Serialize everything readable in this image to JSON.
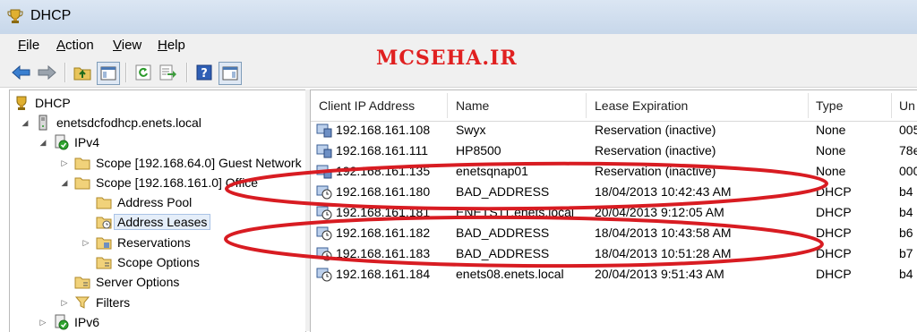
{
  "window": {
    "title": "DHCP"
  },
  "menu": [
    {
      "accel": "F",
      "rest": "ile"
    },
    {
      "accel": "A",
      "rest": "ction"
    },
    {
      "accel": "V",
      "rest": "iew"
    },
    {
      "accel": "H",
      "rest": "elp"
    }
  ],
  "watermark": "MCSEHA.IR",
  "tree": {
    "root": "DHCP",
    "server": "enetsdcfodhcp.enets.local",
    "ipv4": "IPv4",
    "scope1": "Scope [192.168.64.0] Guest Network",
    "scope2": "Scope [192.168.161.0] Office",
    "address_pool": "Address Pool",
    "address_leases": "Address Leases",
    "reservations": "Reservations",
    "scope_options": "Scope Options",
    "server_options": "Server Options",
    "filters": "Filters",
    "ipv6": "IPv6"
  },
  "columns": {
    "ip": "Client IP Address",
    "name": "Name",
    "expiration": "Lease Expiration",
    "type": "Type",
    "unique": "Un"
  },
  "leases": [
    {
      "ip": "192.168.161.108",
      "name": "Swyx",
      "expiration": "Reservation (inactive)",
      "type": "None",
      "unique": "005"
    },
    {
      "ip": "192.168.161.111",
      "name": "HP8500",
      "expiration": "Reservation (inactive)",
      "type": "None",
      "unique": "78e"
    },
    {
      "ip": "192.168.161.135",
      "name": "enetsqnap01",
      "expiration": "Reservation (inactive)",
      "type": "None",
      "unique": "000"
    },
    {
      "ip": "192.168.161.180",
      "name": "BAD_ADDRESS",
      "expiration": "18/04/2013 10:42:43 AM",
      "type": "DHCP",
      "unique": "b4"
    },
    {
      "ip": "192.168.161.181",
      "name": "ENETS11.enets.local",
      "expiration": "20/04/2013 9:12:05 AM",
      "type": "DHCP",
      "unique": "b4"
    },
    {
      "ip": "192.168.161.182",
      "name": "BAD_ADDRESS",
      "expiration": "18/04/2013 10:43:58 AM",
      "type": "DHCP",
      "unique": "b6"
    },
    {
      "ip": "192.168.161.183",
      "name": "BAD_ADDRESS",
      "expiration": "18/04/2013 10:51:28 AM",
      "type": "DHCP",
      "unique": "b7"
    },
    {
      "ip": "192.168.161.184",
      "name": "enets08.enets.local",
      "expiration": "20/04/2013 9:51:43 AM",
      "type": "DHCP",
      "unique": "b4"
    }
  ],
  "colors": {
    "annotation": "#d81c22",
    "watermark": "#e02020",
    "selection": "#e5eef9"
  }
}
